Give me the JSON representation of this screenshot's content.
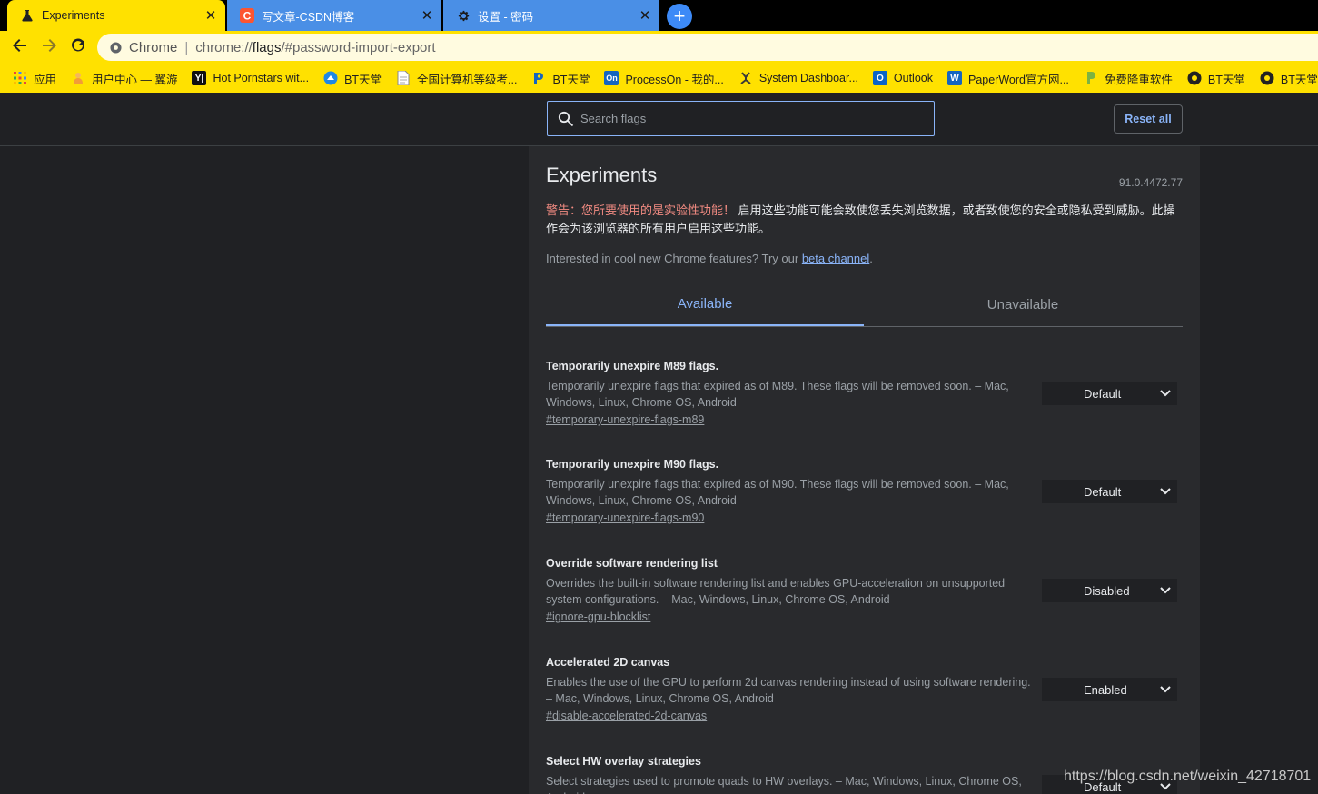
{
  "tabs": [
    {
      "title": "Experiments",
      "icon": "flask-icon",
      "active": true
    },
    {
      "title": "写文章-CSDN博客",
      "icon": "csdn-icon",
      "active": false
    },
    {
      "title": "设置 - 密码",
      "icon": "gear-icon",
      "active": false
    }
  ],
  "tab_close_glyph": "✕",
  "new_tab_glyph": "+",
  "omnibox": {
    "scheme_label": "Chrome",
    "separator": "|",
    "url_pre": "chrome://",
    "url_host": "flags",
    "url_post": "/#password-import-export"
  },
  "bookmarks": [
    {
      "label": "应用",
      "icon": "apps-grid-icon"
    },
    {
      "label": "用户中心 — 翼游",
      "icon": "user-hand-icon"
    },
    {
      "label": "Hot Pornstars wit...",
      "icon": "yj-icon",
      "icon_text": "Y|"
    },
    {
      "label": "BT天堂",
      "icon": "bt-blue-icon"
    },
    {
      "label": "全国计算机等级考...",
      "icon": "document-icon"
    },
    {
      "label": "BT天堂",
      "icon": "bt-p-icon"
    },
    {
      "label": "ProcessOn - 我的...",
      "icon": "processon-icon",
      "icon_text": "On"
    },
    {
      "label": "System Dashboar...",
      "icon": "system-dashboard-icon"
    },
    {
      "label": "Outlook",
      "icon": "outlook-icon",
      "icon_text": "O"
    },
    {
      "label": "PaperWord官方网...",
      "icon": "paperword-icon",
      "icon_text": "W"
    },
    {
      "label": "免费降重软件",
      "icon": "p-logo-icon"
    },
    {
      "label": "BT天堂",
      "icon": "bt-dark-icon"
    },
    {
      "label": "BT天堂",
      "icon": "bt-dark-icon"
    }
  ],
  "search": {
    "placeholder": "Search flags"
  },
  "reset_label": "Reset all",
  "title": "Experiments",
  "version": "91.0.4472.77",
  "warning": {
    "red": "警告：您所要使用的是实验性功能！",
    "rest": "启用这些功能可能会致使您丢失浏览数据，或者致使您的安全或隐私受到威胁。此操作会为该浏览器的所有用户启用这些功能。"
  },
  "beta": {
    "text": "Interested in cool new Chrome features? Try our ",
    "link": "beta channel",
    "suffix": "."
  },
  "flag_tabs": {
    "available": "Available",
    "unavailable": "Unavailable"
  },
  "flags": [
    {
      "name": "Temporarily unexpire M89 flags.",
      "desc": "Temporarily unexpire flags that expired as of M89. These flags will be removed soon. – Mac, Windows, Linux, Chrome OS, Android",
      "link": "#temporary-unexpire-flags-m89",
      "value": "Default"
    },
    {
      "name": "Temporarily unexpire M90 flags.",
      "desc": "Temporarily unexpire flags that expired as of M90. These flags will be removed soon. – Mac, Windows, Linux, Chrome OS, Android",
      "link": "#temporary-unexpire-flags-m90",
      "value": "Default"
    },
    {
      "name": "Override software rendering list",
      "desc": "Overrides the built-in software rendering list and enables GPU-acceleration on unsupported system configurations. – Mac, Windows, Linux, Chrome OS, Android",
      "link": "#ignore-gpu-blocklist",
      "value": "Disabled"
    },
    {
      "name": "Accelerated 2D canvas",
      "desc": "Enables the use of the GPU to perform 2d canvas rendering instead of using software rendering. – Mac, Windows, Linux, Chrome OS, Android",
      "link": "#disable-accelerated-2d-canvas",
      "value": "Enabled"
    },
    {
      "name": "Select HW overlay strategies",
      "desc": "Select strategies used to promote quads to HW overlays. – Mac, Windows, Linux, Chrome OS, Android",
      "link": "",
      "value": "Default"
    }
  ],
  "watermark": "https://blog.csdn.net/weixin_42718701",
  "colors": {
    "toolbar": "#ffe100",
    "inactive_tab": "#4a8fe6",
    "accent": "#8ab4f8",
    "page_bg": "#202124",
    "panel_bg": "#292a2d"
  }
}
